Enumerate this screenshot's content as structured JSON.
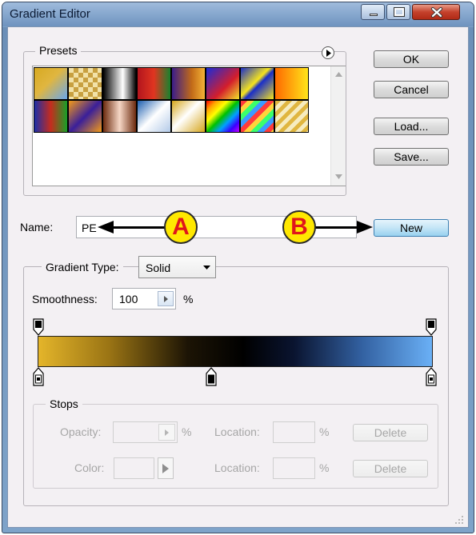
{
  "window": {
    "title": "Gradient Editor"
  },
  "presets": {
    "label": "Presets",
    "swatches": [
      "linear-gradient(135deg,#d7a921 0%,#e0b640 45%,#6aa7ec 100%)",
      "repeating-conic-gradient(#c8a040 0 25%,#f2e2a8 0 50%) 0 0/12px 12px",
      "linear-gradient(90deg,#000 0%,#fff 60%,#000 100%)",
      "linear-gradient(90deg,#b3151e 0%,#e03520 50%,#18822e 100%)",
      "linear-gradient(90deg,#3a1d8a 0%,#c26a18 60%,#f3b236 100%)",
      "linear-gradient(135deg,#1b2bd8 0%,#d41e2c 60%,#f3e32a 100%)",
      "linear-gradient(135deg,#1a2ec9 0%,#f5e41e 45%,#1a2ec9 55%,#f5e41e 100%)",
      "linear-gradient(90deg,#ff6a00 0%,#ffe41a 100%)",
      "linear-gradient(90deg,#1b2ea8 0%,#c52c1e 50%,#18a128 100%)",
      "linear-gradient(135deg,#f39a18 0%,#3a1f9a 50%,#f39a18 100%)",
      "linear-gradient(90deg,#6c2a0e 0%,#f6d7c6 50%,#6c2a0e 100%)",
      "linear-gradient(135deg,#1d5fb0 0%,#fff 50%,#b3cae8 100%)",
      "linear-gradient(135deg,#d6a61c 0%,#fff 45%,#d6a61c 100%)",
      "linear-gradient(135deg,#ff0000,#ffa500,#ffff00,#00c000,#00a0ff,#3a00ff,#c000ff)",
      "repeating-linear-gradient(135deg,#ff3b3b 0 6px,#ffd43b 6px 12px,#3bff6b 12px 18px,#3b9bff 18px 24px)",
      "repeating-linear-gradient(135deg,#e0b640 0 5px,#f6ecc0 5px 10px)"
    ]
  },
  "buttons": {
    "ok": "OK",
    "cancel": "Cancel",
    "load": "Load...",
    "save": "Save...",
    "new": "New",
    "delete1": "Delete",
    "delete2": "Delete"
  },
  "name_field": {
    "label": "Name:",
    "value": "PE"
  },
  "gradient_type": {
    "label": "Gradient Type:",
    "value": "Solid"
  },
  "smoothness": {
    "label": "Smoothness:",
    "value": "100",
    "unit": "%"
  },
  "gradient_bar": {
    "css": "linear-gradient(90deg,#e4b52a 0%,#9a7414 18%,#1c1405 38%,#000000 52%,#0a1430 65%,#3260a0 82%,#6ab0f6 100%)"
  },
  "stops": {
    "label": "Stops",
    "opacity_label": "Opacity:",
    "opacity_unit": "%",
    "color_label": "Color:",
    "location_label_1": "Location:",
    "location_unit_1": "%",
    "location_label_2": "Location:",
    "location_unit_2": "%"
  },
  "annotations": {
    "a": "A",
    "b": "B"
  }
}
